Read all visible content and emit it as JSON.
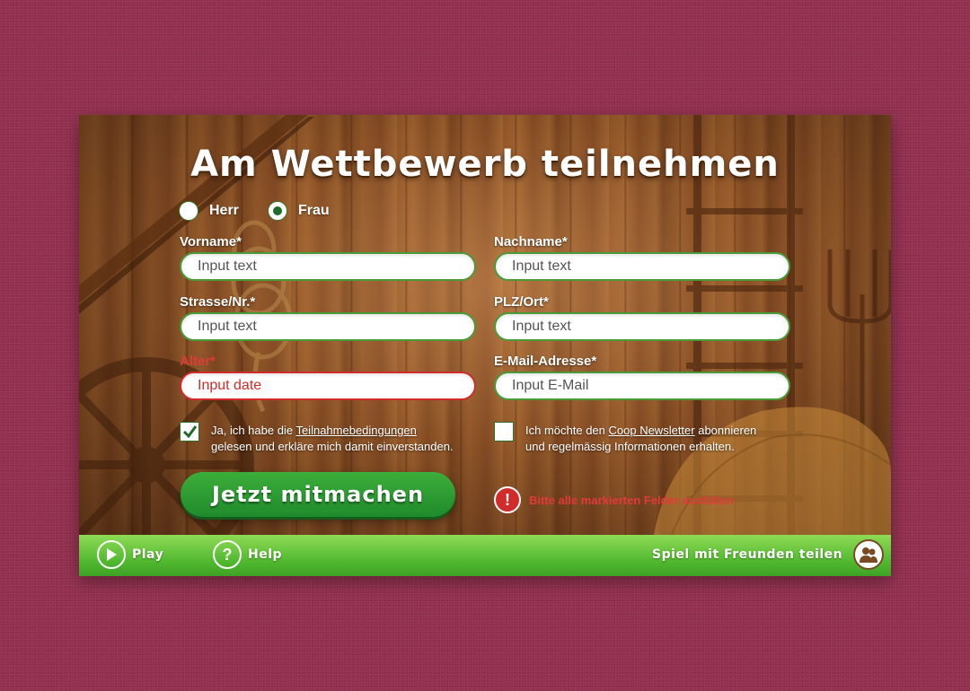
{
  "title": "Am Wettbewerb teilnehmen",
  "gender": {
    "options": [
      {
        "label": "Herr",
        "checked": false
      },
      {
        "label": "Frau",
        "checked": true
      }
    ]
  },
  "fields": {
    "firstname": {
      "label": "Vorname*",
      "placeholder": "Input text"
    },
    "lastname": {
      "label": "Nachname*",
      "placeholder": "Input text"
    },
    "street": {
      "label": "Strasse/Nr.*",
      "placeholder": "Input text"
    },
    "city": {
      "label": "PLZ/Ort*",
      "placeholder": "Input text"
    },
    "age": {
      "label": "Alter*",
      "placeholder": "Input date",
      "error": true
    },
    "email": {
      "label": "E-Mail-Adresse*",
      "placeholder": "Input E-Mail"
    }
  },
  "terms": {
    "checked": true,
    "before": "Ja, ich habe die ",
    "link": "Teilnahmebedingungen",
    "after": "gelesen und erkläre mich damit einverstanden."
  },
  "newsletter": {
    "checked": false,
    "before": "Ich möchte den ",
    "link": "Coop Newsletter",
    "middle": " abonnieren",
    "after": "und regelmässig Informationen erhalten."
  },
  "submit_label": "Jetzt mitmachen",
  "error_message": "Bitte alle markierten Felder ausfüllen",
  "footer": {
    "play_label": "Play",
    "help_label": "Help",
    "share_label": "Spiel mit Freunden teilen"
  },
  "colors": {
    "background": "#93304f",
    "accent_green": "#2f9a2f",
    "error_red": "#d12b2b"
  }
}
